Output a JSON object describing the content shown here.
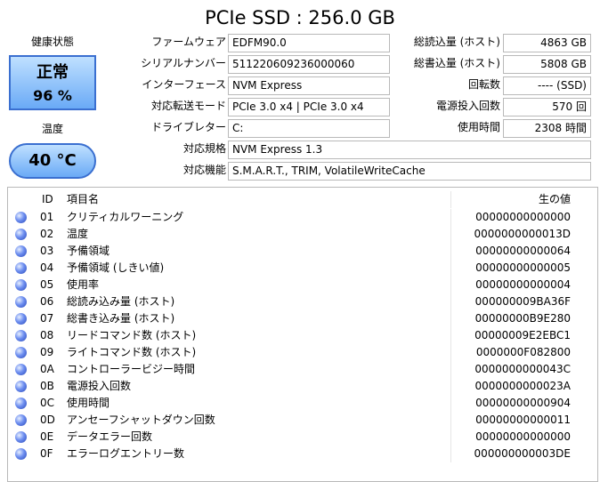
{
  "title": "PCIe SSD : 256.0 GB",
  "health": {
    "label": "健康状態",
    "status": "正常",
    "percent": "96 %"
  },
  "temperature": {
    "label": "温度",
    "value": "40 °C"
  },
  "info": {
    "firmware": {
      "label": "ファームウェア",
      "value": "EDFM90.0"
    },
    "serial": {
      "label": "シリアルナンバー",
      "value": "511220609236000060"
    },
    "interface": {
      "label": "インターフェース",
      "value": "NVM Express"
    },
    "transfer_mode": {
      "label": "対応転送モード",
      "value": "PCIe 3.0 x4 | PCIe 3.0 x4"
    },
    "drive_letter": {
      "label": "ドライブレター",
      "value": "C:"
    },
    "standard": {
      "label": "対応規格",
      "value": "NVM Express 1.3"
    },
    "features": {
      "label": "対応機能",
      "value": "S.M.A.R.T., TRIM, VolatileWriteCache"
    }
  },
  "stats": {
    "host_reads": {
      "label": "総読込量 (ホスト)",
      "value": "4863 GB"
    },
    "host_writes": {
      "label": "総書込量 (ホスト)",
      "value": "5808 GB"
    },
    "rotation": {
      "label": "回転数",
      "value": "---- (SSD)"
    },
    "power_on_count": {
      "label": "電源投入回数",
      "value": "570 回"
    },
    "power_on_hours": {
      "label": "使用時間",
      "value": "2308 時間"
    }
  },
  "smart": {
    "headers": {
      "id": "ID",
      "name": "項目名",
      "raw": "生の値"
    },
    "rows": [
      {
        "id": "01",
        "name": "クリティカルワーニング",
        "raw": "00000000000000"
      },
      {
        "id": "02",
        "name": "温度",
        "raw": "0000000000013D"
      },
      {
        "id": "03",
        "name": "予備領域",
        "raw": "00000000000064"
      },
      {
        "id": "04",
        "name": "予備領域 (しきい値)",
        "raw": "00000000000005"
      },
      {
        "id": "05",
        "name": "使用率",
        "raw": "00000000000004"
      },
      {
        "id": "06",
        "name": "総読み込み量 (ホスト)",
        "raw": "000000009BA36F"
      },
      {
        "id": "07",
        "name": "総書き込み量 (ホスト)",
        "raw": "00000000B9E280"
      },
      {
        "id": "08",
        "name": "リードコマンド数 (ホスト)",
        "raw": "00000009E2EBC1"
      },
      {
        "id": "09",
        "name": "ライトコマンド数 (ホスト)",
        "raw": "0000000F082800"
      },
      {
        "id": "0A",
        "name": "コントローラービジー時間",
        "raw": "0000000000043C"
      },
      {
        "id": "0B",
        "name": "電源投入回数",
        "raw": "0000000000023A"
      },
      {
        "id": "0C",
        "name": "使用時間",
        "raw": "00000000000904"
      },
      {
        "id": "0D",
        "name": "アンセーフシャットダウン回数",
        "raw": "00000000000011"
      },
      {
        "id": "0E",
        "name": "データエラー回数",
        "raw": "00000000000000"
      },
      {
        "id": "0F",
        "name": "エラーログエントリー数",
        "raw": "000000000003DE"
      }
    ]
  }
}
